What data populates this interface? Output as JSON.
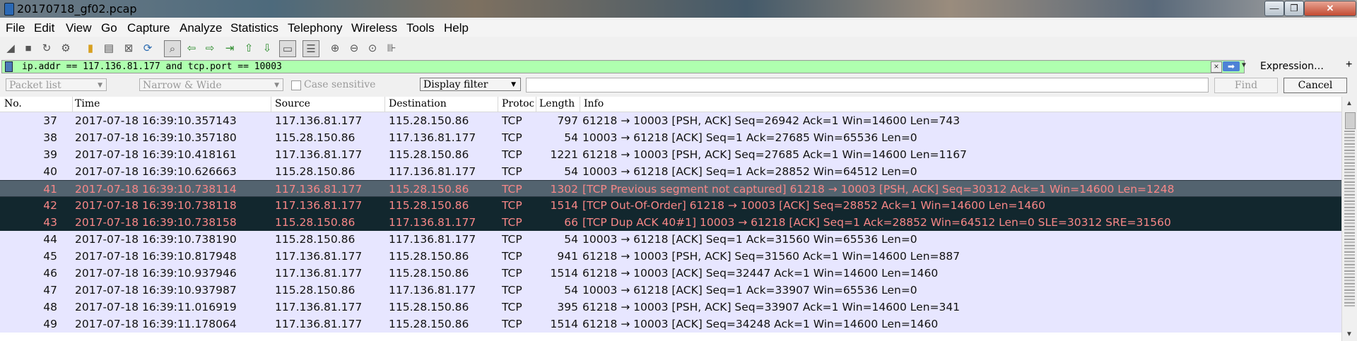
{
  "window": {
    "title": "20170718_gf02.pcap",
    "minimize": "—",
    "maximize": "❐",
    "close": "✕"
  },
  "menu": [
    "File",
    "Edit",
    "View",
    "Go",
    "Capture",
    "Analyze",
    "Statistics",
    "Telephony",
    "Wireless",
    "Tools",
    "Help"
  ],
  "filter": {
    "value": "ip.addr == 117.136.81.177 and tcp.port == 10003",
    "expression_label": "Expression…",
    "add_label": "+",
    "background": "#afffaf"
  },
  "find": {
    "search_in": "Packet list",
    "char_width": "Narrow & Wide",
    "case_sensitive_label": "Case sensitive",
    "search_type": "Display filter",
    "find_label": "Find",
    "cancel_label": "Cancel"
  },
  "columns": {
    "no": "No.",
    "time": "Time",
    "source": "Source",
    "destination": "Destination",
    "protocol": "Protoc",
    "length": "Length",
    "info": "Info"
  },
  "packets": [
    {
      "no": "37",
      "time": "2017-07-18 16:39:10.357143",
      "src": "117.136.81.177",
      "dst": "115.28.150.86",
      "proto": "TCP",
      "len": "797",
      "info": "61218 → 10003 [PSH, ACK] Seq=26942 Ack=1 Win=14600 Len=743",
      "style": "normal"
    },
    {
      "no": "38",
      "time": "2017-07-18 16:39:10.357180",
      "src": "115.28.150.86",
      "dst": "117.136.81.177",
      "proto": "TCP",
      "len": "54",
      "info": "10003 → 61218 [ACK] Seq=1 Ack=27685 Win=65536 Len=0",
      "style": "normal"
    },
    {
      "no": "39",
      "time": "2017-07-18 16:39:10.418161",
      "src": "117.136.81.177",
      "dst": "115.28.150.86",
      "proto": "TCP",
      "len": "1221",
      "info": "61218 → 10003 [PSH, ACK] Seq=27685 Ack=1 Win=14600 Len=1167",
      "style": "normal"
    },
    {
      "no": "40",
      "time": "2017-07-18 16:39:10.626663",
      "src": "115.28.150.86",
      "dst": "117.136.81.177",
      "proto": "TCP",
      "len": "54",
      "info": "10003 → 61218 [ACK] Seq=1 Ack=28852 Win=64512 Len=0",
      "style": "normal"
    },
    {
      "no": "41",
      "time": "2017-07-18 16:39:10.738114",
      "src": "117.136.81.177",
      "dst": "115.28.150.86",
      "proto": "TCP",
      "len": "1302",
      "info": "[TCP Previous segment not captured] 61218 → 10003 [PSH, ACK] Seq=30312 Ack=1 Win=14600 Len=1248",
      "style": "selected"
    },
    {
      "no": "42",
      "time": "2017-07-18 16:39:10.738118",
      "src": "117.136.81.177",
      "dst": "115.28.150.86",
      "proto": "TCP",
      "len": "1514",
      "info": "[TCP Out-Of-Order] 61218 → 10003 [ACK] Seq=28852 Ack=1 Win=14600 Len=1460",
      "style": "dark"
    },
    {
      "no": "43",
      "time": "2017-07-18 16:39:10.738158",
      "src": "115.28.150.86",
      "dst": "117.136.81.177",
      "proto": "TCP",
      "len": "66",
      "info": "[TCP Dup ACK 40#1] 10003 → 61218 [ACK] Seq=1 Ack=28852 Win=64512 Len=0 SLE=30312 SRE=31560",
      "style": "dark"
    },
    {
      "no": "44",
      "time": "2017-07-18 16:39:10.738190",
      "src": "115.28.150.86",
      "dst": "117.136.81.177",
      "proto": "TCP",
      "len": "54",
      "info": "10003 → 61218 [ACK] Seq=1 Ack=31560 Win=65536 Len=0",
      "style": "normal"
    },
    {
      "no": "45",
      "time": "2017-07-18 16:39:10.817948",
      "src": "117.136.81.177",
      "dst": "115.28.150.86",
      "proto": "TCP",
      "len": "941",
      "info": "61218 → 10003 [PSH, ACK] Seq=31560 Ack=1 Win=14600 Len=887",
      "style": "normal"
    },
    {
      "no": "46",
      "time": "2017-07-18 16:39:10.937946",
      "src": "117.136.81.177",
      "dst": "115.28.150.86",
      "proto": "TCP",
      "len": "1514",
      "info": "61218 → 10003 [ACK] Seq=32447 Ack=1 Win=14600 Len=1460",
      "style": "normal"
    },
    {
      "no": "47",
      "time": "2017-07-18 16:39:10.937987",
      "src": "115.28.150.86",
      "dst": "117.136.81.177",
      "proto": "TCP",
      "len": "54",
      "info": "10003 → 61218 [ACK] Seq=1 Ack=33907 Win=65536 Len=0",
      "style": "normal"
    },
    {
      "no": "48",
      "time": "2017-07-18 16:39:11.016919",
      "src": "117.136.81.177",
      "dst": "115.28.150.86",
      "proto": "TCP",
      "len": "395",
      "info": "61218 → 10003 [PSH, ACK] Seq=33907 Ack=1 Win=14600 Len=341",
      "style": "normal"
    },
    {
      "no": "49",
      "time": "2017-07-18 16:39:11.178064",
      "src": "117.136.81.177",
      "dst": "115.28.150.86",
      "proto": "TCP",
      "len": "1514",
      "info": "61218 → 10003 [ACK] Seq=34248 Ack=1 Win=14600 Len=1460",
      "style": "normal"
    }
  ],
  "colors": {
    "tcp_row": "#e7e6ff",
    "selected_row": "#53636f",
    "bad_tcp_row": "#12272e",
    "bad_tcp_text": "#f78787"
  },
  "toolbar_icons": [
    "start-capture-icon",
    "stop-capture-icon",
    "restart-capture-icon",
    "capture-options-icon",
    "open-file-icon",
    "save-file-icon",
    "close-file-icon",
    "reload-file-icon",
    "find-packet-icon",
    "go-back-icon",
    "go-forward-icon",
    "go-to-packet-icon",
    "first-packet-icon",
    "last-packet-icon",
    "autoscroll-icon",
    "colorize-icon",
    "zoom-in-icon",
    "zoom-out-icon",
    "normal-size-icon",
    "resize-columns-icon"
  ]
}
